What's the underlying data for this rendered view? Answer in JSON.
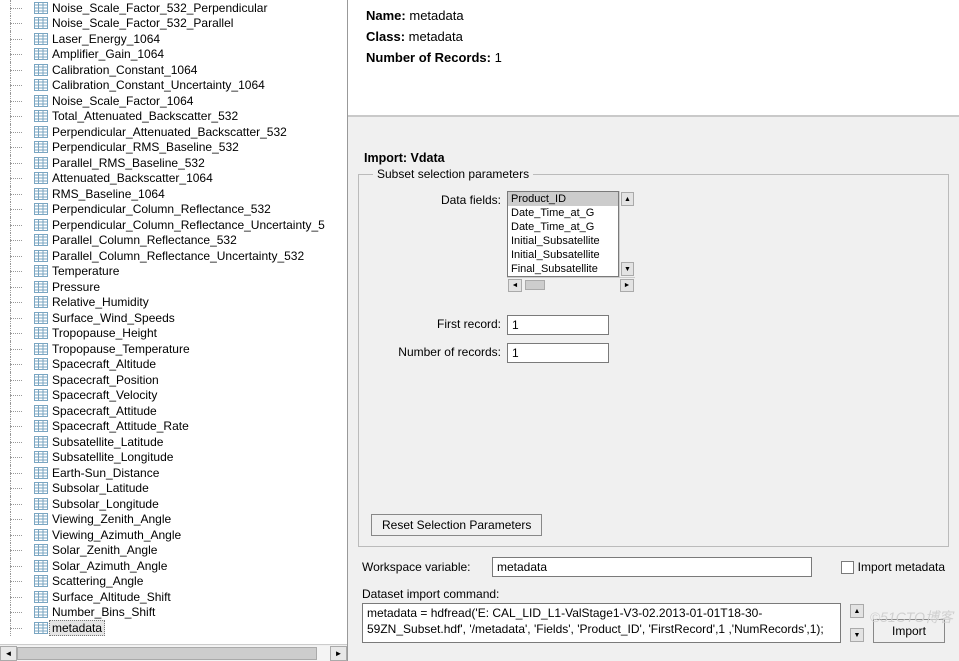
{
  "tree_items": [
    "Noise_Scale_Factor_532_Perpendicular",
    "Noise_Scale_Factor_532_Parallel",
    "Laser_Energy_1064",
    "Amplifier_Gain_1064",
    "Calibration_Constant_1064",
    "Calibration_Constant_Uncertainty_1064",
    "Noise_Scale_Factor_1064",
    "Total_Attenuated_Backscatter_532",
    "Perpendicular_Attenuated_Backscatter_532",
    "Perpendicular_RMS_Baseline_532",
    "Parallel_RMS_Baseline_532",
    "Attenuated_Backscatter_1064",
    "RMS_Baseline_1064",
    "Perpendicular_Column_Reflectance_532",
    "Perpendicular_Column_Reflectance_Uncertainty_5",
    "Parallel_Column_Reflectance_532",
    "Parallel_Column_Reflectance_Uncertainty_532",
    "Temperature",
    "Pressure",
    "Relative_Humidity",
    "Surface_Wind_Speeds",
    "Tropopause_Height",
    "Tropopause_Temperature",
    "Spacecraft_Altitude",
    "Spacecraft_Position",
    "Spacecraft_Velocity",
    "Spacecraft_Attitude",
    "Spacecraft_Attitude_Rate",
    "Subsatellite_Latitude",
    "Subsatellite_Longitude",
    "Earth-Sun_Distance",
    "Subsolar_Latitude",
    "Subsolar_Longitude",
    "Viewing_Zenith_Angle",
    "Viewing_Azimuth_Angle",
    "Solar_Zenith_Angle",
    "Solar_Azimuth_Angle",
    "Scattering_Angle",
    "Surface_Altitude_Shift",
    "Number_Bins_Shift",
    "metadata"
  ],
  "selected_tree_item": "metadata",
  "info": {
    "name_label": "Name:",
    "name_value": "metadata",
    "class_label": "Class:",
    "class_value": "metadata",
    "records_label": "Number of Records:",
    "records_value": "1"
  },
  "import_section_title": "Import: Vdata",
  "subset_legend": "Subset selection parameters",
  "df_label": "Data fields:",
  "data_fields": [
    "Product_ID",
    "Date_Time_at_G",
    "Date_Time_at_G",
    "Initial_Subsatellite",
    "Initial_Subsatellite",
    "Final_Subsatellite"
  ],
  "data_fields_selected": "Product_ID",
  "first_record_label": "First record:",
  "first_record_value": "1",
  "num_records_label": "Number of records:",
  "num_records_value": "1",
  "reset_button": "Reset Selection Parameters",
  "ws_label": "Workspace variable:",
  "ws_value": "metadata",
  "import_meta_label": "Import metadata",
  "cmd_label": "Dataset import command:",
  "cmd_value": "metadata = hdfread('E:                                                                                                CAL_LID_L1-ValStage1-V3-02.2013-01-01T18-30-59ZN_Subset.hdf', '/metadata', 'Fields', 'Product_ID', 'FirstRecord',1 ,'NumRecords',1);",
  "import_button": "Import",
  "watermark": "©51CTO博客"
}
